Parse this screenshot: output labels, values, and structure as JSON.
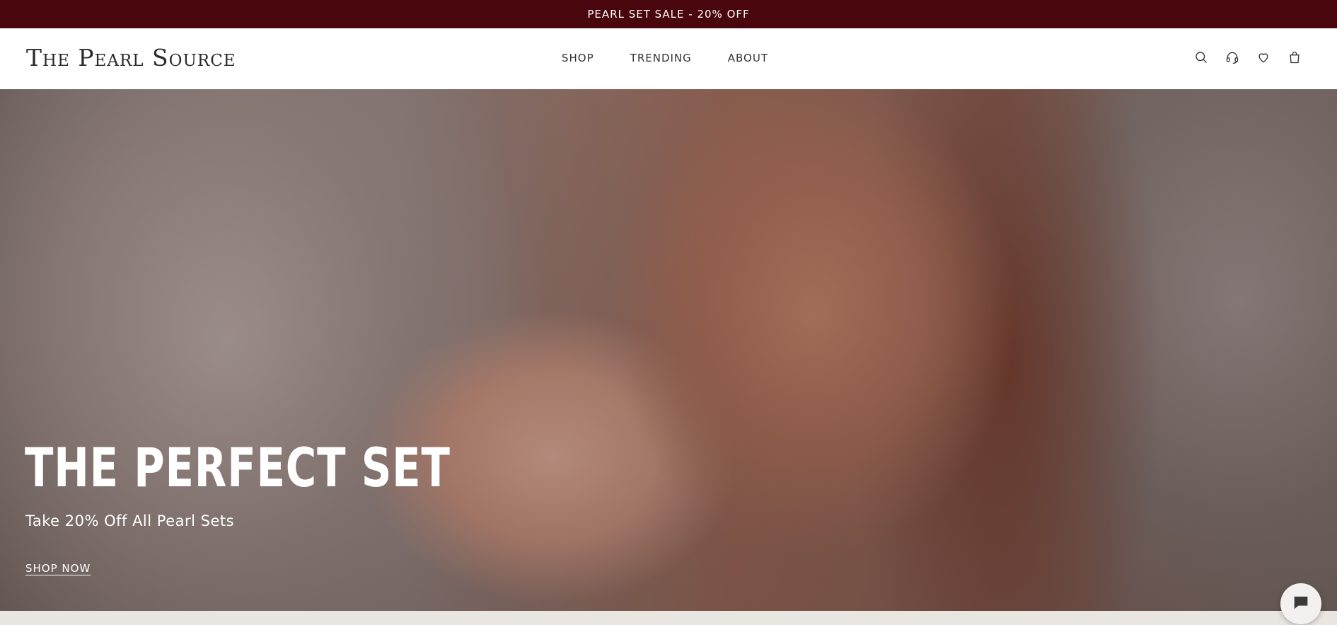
{
  "announcement": {
    "text": "PEARL SET SALE - 20% OFF"
  },
  "header": {
    "logo": "The Pearl Source",
    "nav": [
      {
        "label": "SHOP"
      },
      {
        "label": "TRENDING"
      },
      {
        "label": "ABOUT"
      }
    ],
    "icons": [
      "search-icon",
      "support-headset-icon",
      "heart-icon",
      "shopping-bag-icon"
    ]
  },
  "hero": {
    "title": "THE PERFECT SET",
    "subtitle": "Take 20% Off All Pearl Sets",
    "cta": "SHOP NOW"
  },
  "chat": {
    "icon": "chat-icon"
  },
  "colors": {
    "announcement_bg": "#49060d",
    "header_bg": "#ffffff",
    "hero_text": "#ffffff"
  }
}
